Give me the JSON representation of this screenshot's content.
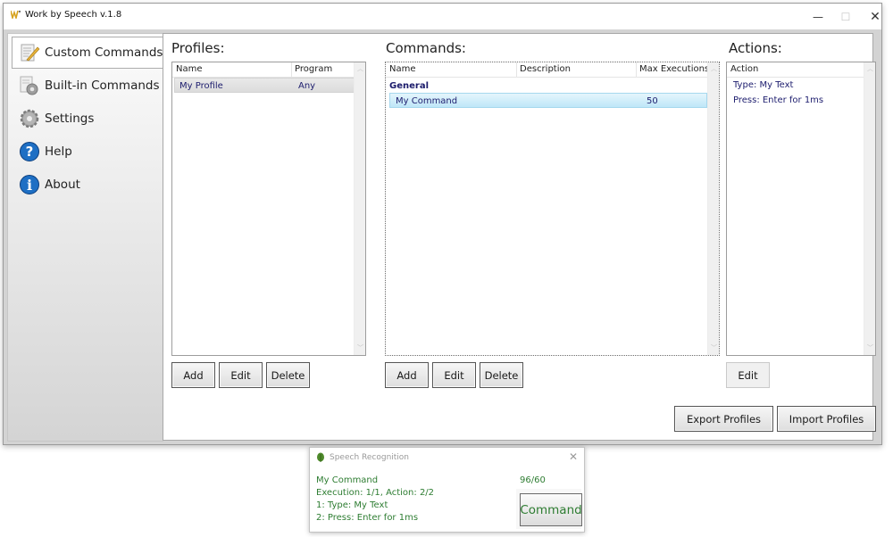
{
  "window": {
    "title": "Work by Speech v.1.8",
    "controls": {
      "minimize": "—",
      "maximize": "☐",
      "close": "✕"
    }
  },
  "sidebar": {
    "items": [
      {
        "label": "Custom Commands",
        "icon": "notepad-pencil-icon",
        "active": true
      },
      {
        "label": "Built-in Commands",
        "icon": "document-gear-icon",
        "active": false
      },
      {
        "label": "Settings",
        "icon": "gear-icon",
        "active": false
      },
      {
        "label": "Help",
        "icon": "help-question-icon",
        "active": false
      },
      {
        "label": "About",
        "icon": "info-icon",
        "active": false
      }
    ]
  },
  "profiles": {
    "title": "Profiles:",
    "columns": [
      "Name",
      "Program"
    ],
    "rows": [
      {
        "name": "My Profile",
        "program": "Any",
        "selected": true
      }
    ],
    "buttons": {
      "add": "Add",
      "edit": "Edit",
      "delete": "Delete"
    }
  },
  "commands": {
    "title": "Commands:",
    "columns": [
      "Name",
      "Description",
      "Max Executions"
    ],
    "groups": [
      {
        "name": "General",
        "rows": [
          {
            "name": "My Command",
            "description": "",
            "max_executions": "50",
            "selected": true
          }
        ]
      }
    ],
    "buttons": {
      "add": "Add",
      "edit": "Edit",
      "delete": "Delete"
    }
  },
  "actions": {
    "title": "Actions:",
    "columns": [
      "Action"
    ],
    "items": [
      "Type: My Text",
      "Press: Enter for 1ms"
    ],
    "buttons": {
      "edit": "Edit"
    }
  },
  "footer_buttons": {
    "export": "Export Profiles",
    "import": "Import Profiles"
  },
  "speech_popup": {
    "title": "Speech Recognition",
    "close": "✕",
    "lines": [
      "My Command",
      "Execution: 1/1, Action: 2/2",
      "1: Type: My Text",
      "2: Press: Enter for 1ms"
    ],
    "counter": "96/60",
    "mode_button": "Command",
    "text_color": "#2e7d32"
  },
  "scroll_glyphs": {
    "up": "︿",
    "down": "﹀"
  }
}
